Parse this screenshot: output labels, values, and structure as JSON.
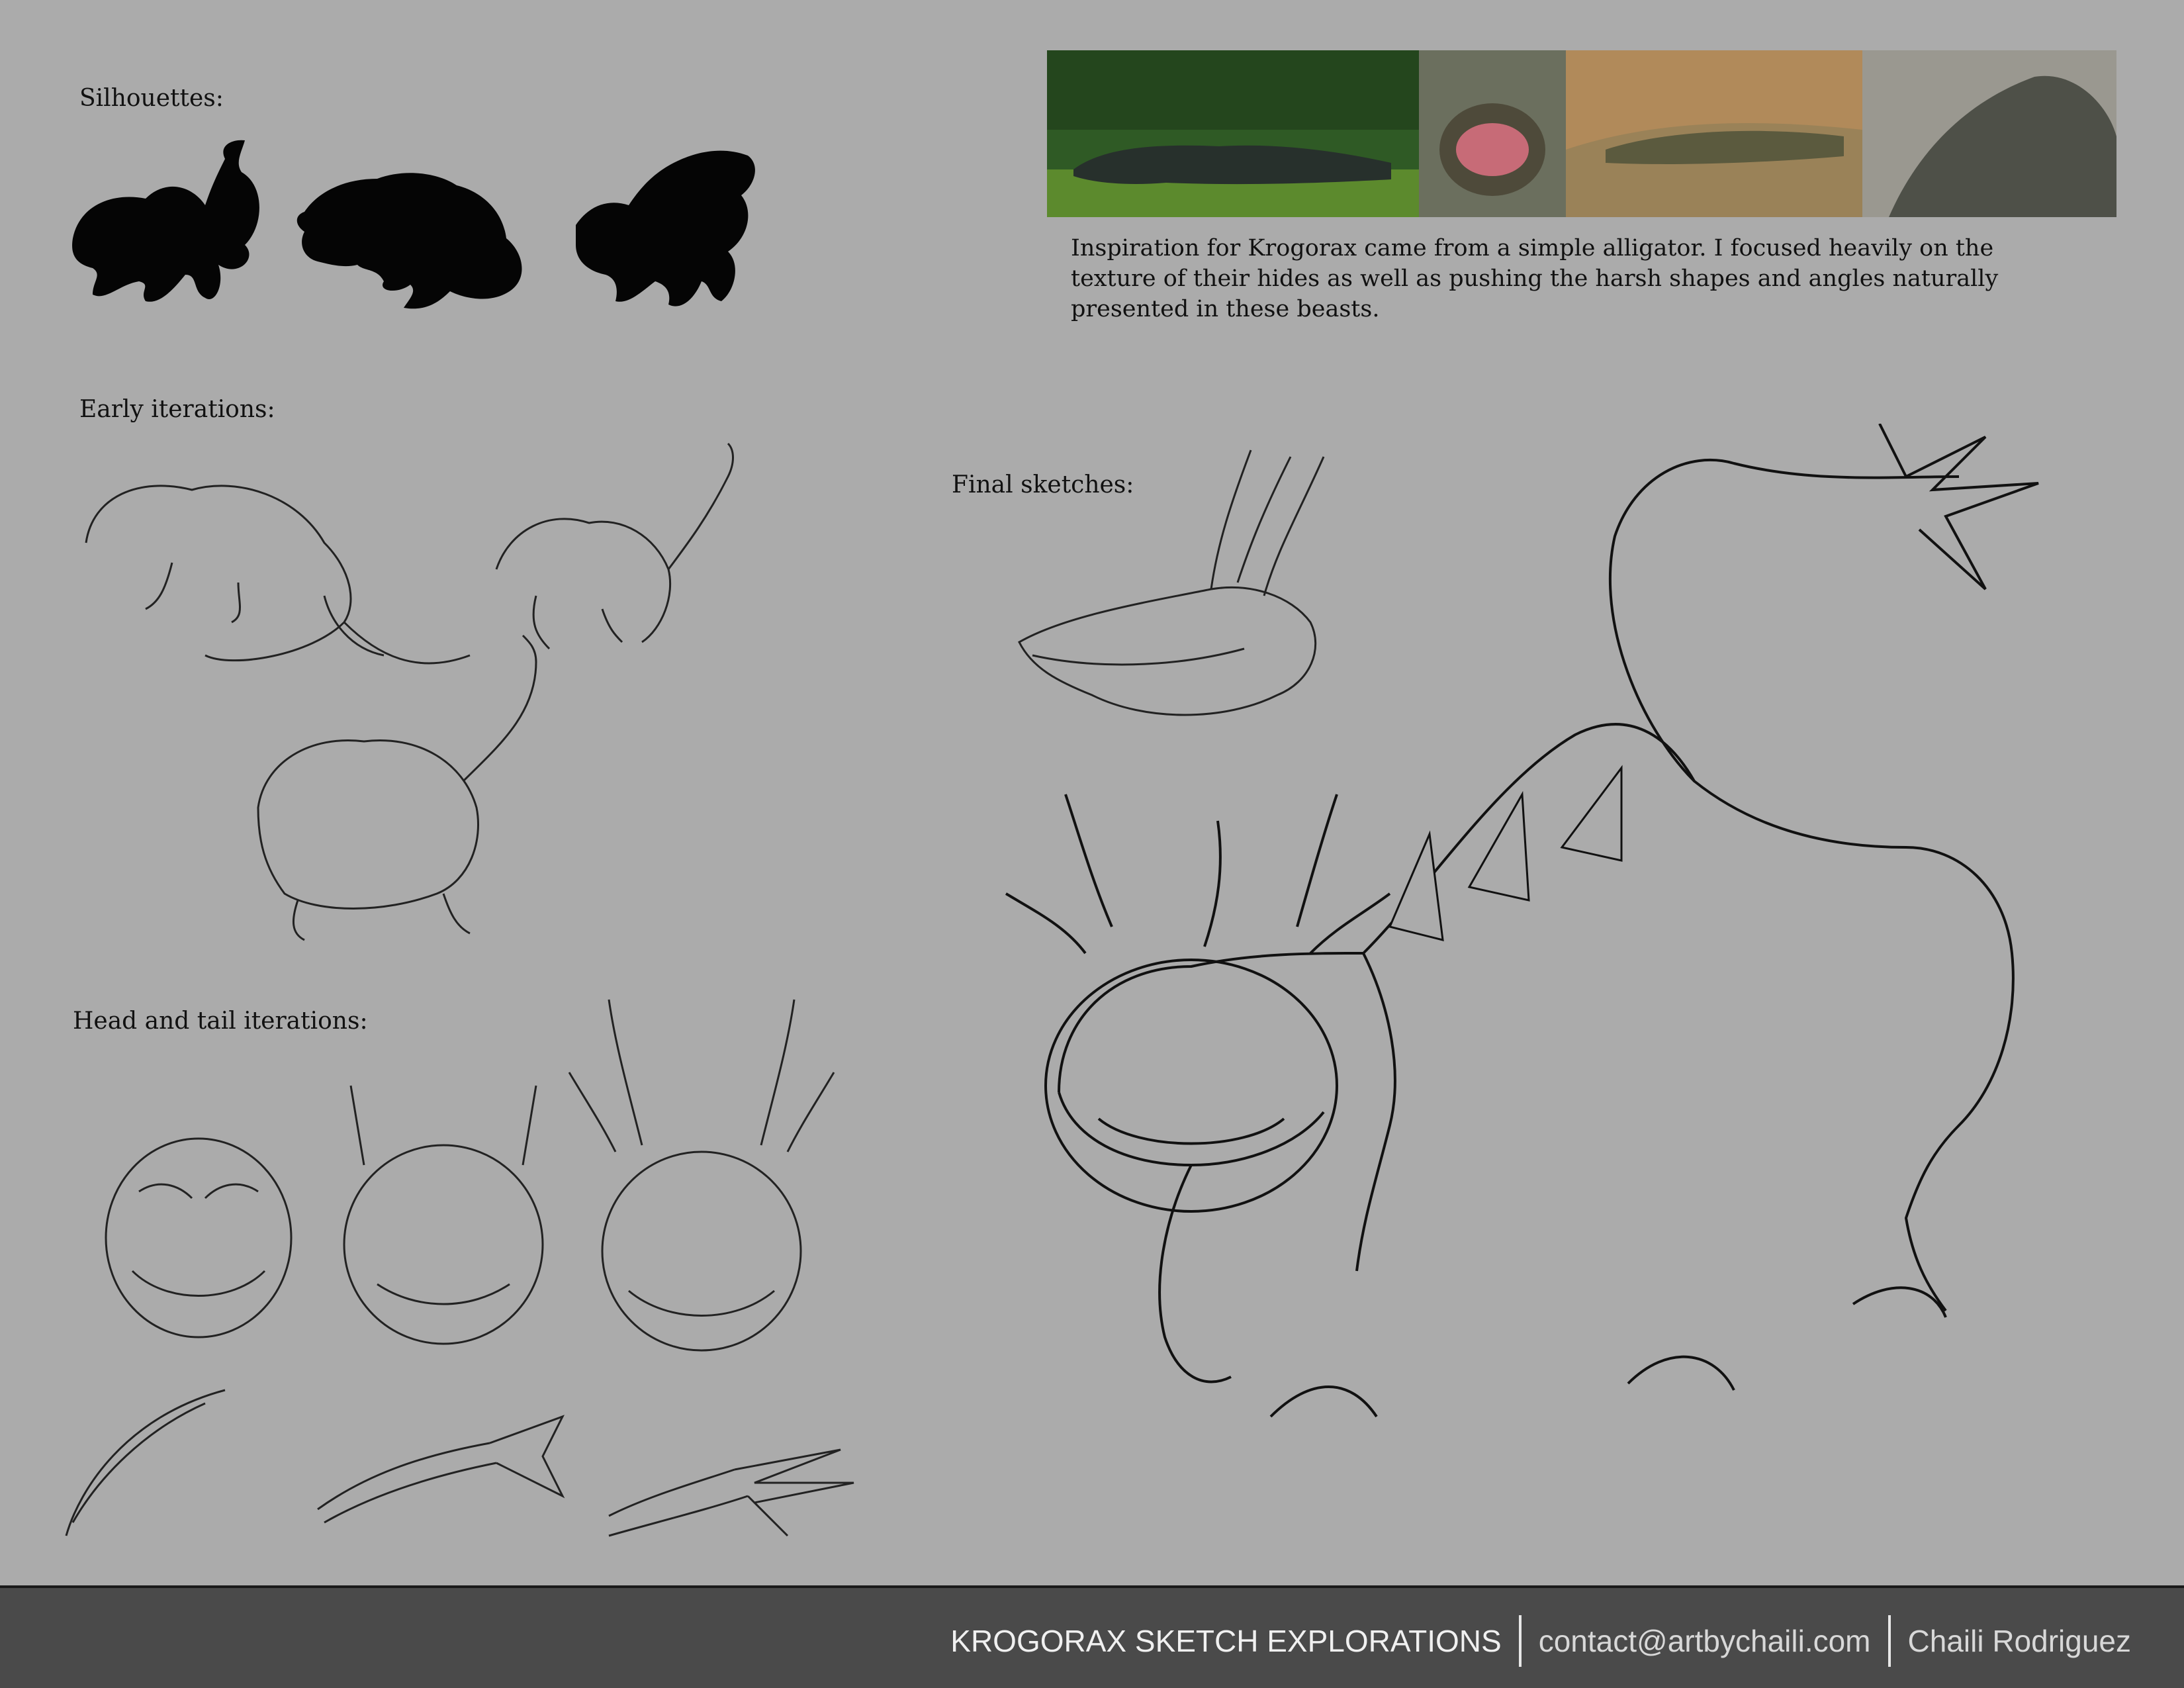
{
  "sections": {
    "silhouettes": "Silhouettes:",
    "early": "Early iterations:",
    "head_tail": "Head and tail iterations:",
    "final": "Final sketches:"
  },
  "caption": {
    "line1": "Inspiration for Krogorax came from a simple alligator.  I focused heavily on the",
    "line2": "texture of their hides as well as pushing the harsh shapes and angles naturally",
    "line3": "presented in these beasts."
  },
  "footer": {
    "title": "KROGORAX SKETCH EXPLORATIONS",
    "contact": "contact@artbychaili.com",
    "author": "Chaili Rodriguez"
  },
  "colors": {
    "background": "#ababab",
    "footer": "#4a4a4a",
    "ink": "#111111"
  }
}
